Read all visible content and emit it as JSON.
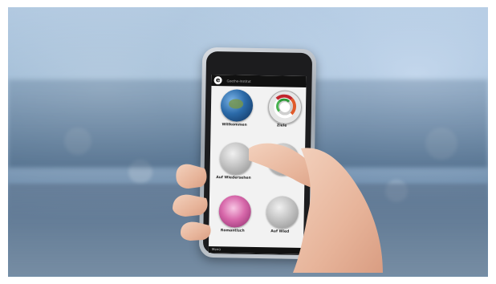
{
  "app": {
    "title": "Goethe-Institut",
    "logo_letter": "e"
  },
  "tiles": [
    {
      "label": "Willkommen",
      "icon": "earth-icon"
    },
    {
      "label": "Ziele",
      "icon": "target-icon"
    },
    {
      "label": "Auf Wiedersehen",
      "icon": "moon-icon"
    },
    {
      "label": "",
      "icon": "moon-icon"
    },
    {
      "label": "Romantisch",
      "icon": "pink-sparkle-icon"
    },
    {
      "label": "Auf Wied",
      "icon": "moon-icon"
    }
  ],
  "menu": {
    "label": "Menü"
  },
  "colors": {
    "background_blue": "#7594b3",
    "appbar": "#111111",
    "accent_red": "#c0262d",
    "accent_green": "#2f9a3a"
  }
}
